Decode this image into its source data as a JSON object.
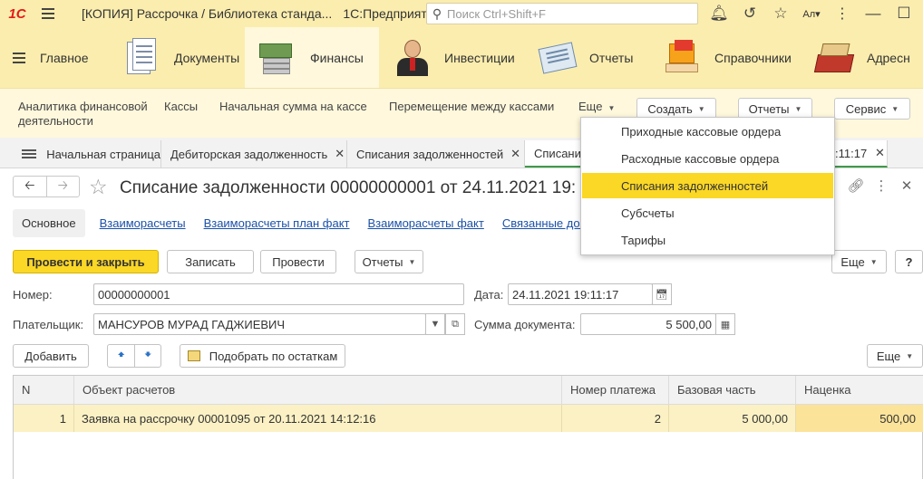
{
  "titlebar": {
    "logo": "1С",
    "title": "[КОПИЯ] Рассрочка / Библиотека станда...",
    "app": "1С:Предприятие",
    "search_placeholder": "Поиск Ctrl+Shift+F",
    "user": "Ал▾"
  },
  "sections": [
    {
      "label": "Главное"
    },
    {
      "label": "Документы"
    },
    {
      "label": "Финансы"
    },
    {
      "label": "Инвестиции"
    },
    {
      "label": "Отчеты"
    },
    {
      "label": "Справочники"
    },
    {
      "label": "Адресн"
    }
  ],
  "commands": {
    "analytics": "Аналитика финансовой деятельности",
    "cash": "Кассы",
    "initial_sum": "Начальная сумма на кассе",
    "transfer": "Перемещение между кассами",
    "more": "Еще",
    "create": "Создать",
    "reports": "Отчеты",
    "service": "Сервис"
  },
  "tabs": [
    {
      "label": "Начальная страница"
    },
    {
      "label": "Дебиторская задолженность"
    },
    {
      "label": "Списания задолженностей"
    },
    {
      "label": "Списани"
    },
    {
      "label": ":11:17"
    }
  ],
  "form": {
    "title": "Списание задолженности 00000000001 от 24.11.2021 19:",
    "links": {
      "main": "Основное",
      "settlements": "Взаиморасчеты",
      "settlements_plan": "Взаиморасчеты план факт",
      "settlements_fact": "Взаиморасчеты факт",
      "related": "Связанные доку"
    },
    "buttons": {
      "post_close": "Провести и закрыть",
      "save": "Записать",
      "post": "Провести",
      "reports": "Отчеты",
      "more": "Еще",
      "help": "?"
    },
    "number_label": "Номер:",
    "number_value": "00000000001",
    "date_label": "Дата:",
    "date_value": "24.11.2021 19:11:17",
    "payer_label": "Плательщик:",
    "payer_value": "МАНСУРОВ МУРАД ГАДЖИЕВИЧ",
    "sum_label": "Сумма документа:",
    "sum_value": "5 500,00"
  },
  "table_bar": {
    "add": "Добавить",
    "pick": "Подобрать по остаткам",
    "more": "Еще"
  },
  "table": {
    "columns": [
      "N",
      "Объект расчетов",
      "Номер платежа",
      "Базовая часть",
      "Наценка"
    ],
    "rows": [
      [
        "1",
        "Заявка на рассрочку 00001095 от 20.11.2021 14:12:16",
        "2",
        "5 000,00",
        "500,00"
      ]
    ]
  },
  "dropdown": {
    "items": [
      "Приходные кассовые ордера",
      "Расходные кассовые ордера",
      "Списания задолженностей",
      "Субсчеты",
      "Тарифы"
    ],
    "highlighted": "Списания задолженностей"
  },
  "colors": {
    "accent_yellow": "#fbd726",
    "panel": "#fbedae",
    "link": "#1b51a8"
  }
}
